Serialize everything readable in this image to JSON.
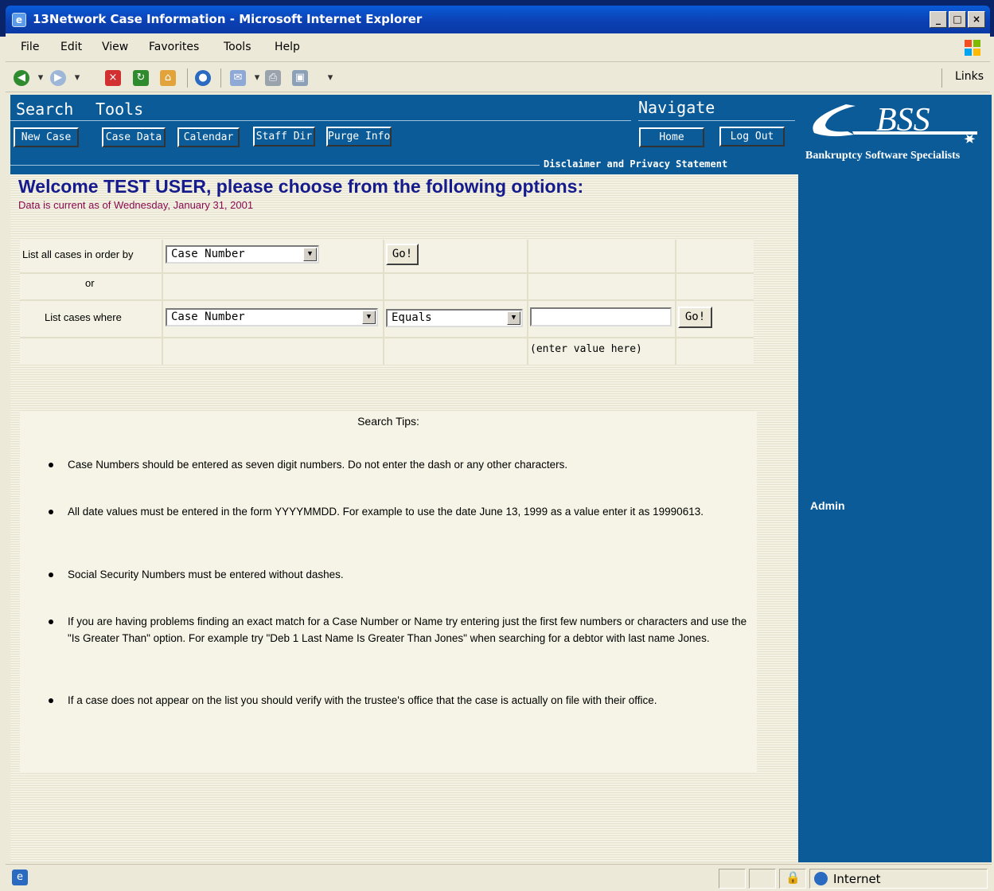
{
  "window": {
    "title": "13Network Case Information - Microsoft Internet Explorer",
    "controls": [
      "_",
      "□",
      "×"
    ]
  },
  "menu": [
    "File",
    "Edit",
    "View",
    "Favorites",
    "Tools",
    "Help"
  ],
  "toolbar": {
    "links_label": "Links"
  },
  "header": {
    "search_label": "Search",
    "tools_label": "Tools",
    "navigate_label": "Navigate",
    "buttons": {
      "new_case": "New Case",
      "case_data": "Case Data",
      "calendar": "Calendar",
      "staff_dir": "Staff Dir",
      "purge_info": "Purge Info",
      "home": "Home",
      "log_out": "Log Out"
    },
    "disclaimer": "Disclaimer and Privacy Statement"
  },
  "logo": {
    "mark": "BSS",
    "tagline": "Bankruptcy Software Specialists"
  },
  "main": {
    "welcome": "Welcome TEST USER, please choose from the following options:",
    "data_current": "Data is current as of Wednesday, January 31, 2001"
  },
  "search": {
    "list_all_label": "List all cases in order by",
    "order_by_value": "Case Number",
    "go_label": "Go!",
    "or_label": "or",
    "list_where_label": "List cases where",
    "field_value": "Case Number",
    "operator_value": "Equals",
    "value_input": "",
    "enter_value_hint": "(enter value here)"
  },
  "tips": {
    "title": "Search Tips:",
    "items": [
      "Case Numbers should be entered as seven digit numbers.   Do not enter the dash or any other characters.",
      "All date values must be entered in the form YYYYMMDD.   For example to use the date June 13, 1999 as a value enter it as 19990613.",
      "Social Security Numbers must be entered without dashes.",
      "If you are having problems finding an exact match for a Case Number or Name try entering just the first few numbers or characters and use the \"Is Greater Than\" option.  For example try \"Deb 1 Last Name Is Greater Than Jones\" when searching for a debtor with last name Jones.",
      "If a case does not appear on the list you should verify with the trustee's office that the case is actually on file with their office."
    ]
  },
  "sidebar": {
    "admin_label": "Admin"
  },
  "statusbar": {
    "zone": "Internet"
  },
  "colors": {
    "header_bg": "#0A5B98",
    "welcome_text": "#151A8C",
    "date_text": "#8B0A50",
    "content_bg": "#F3F2E4"
  }
}
